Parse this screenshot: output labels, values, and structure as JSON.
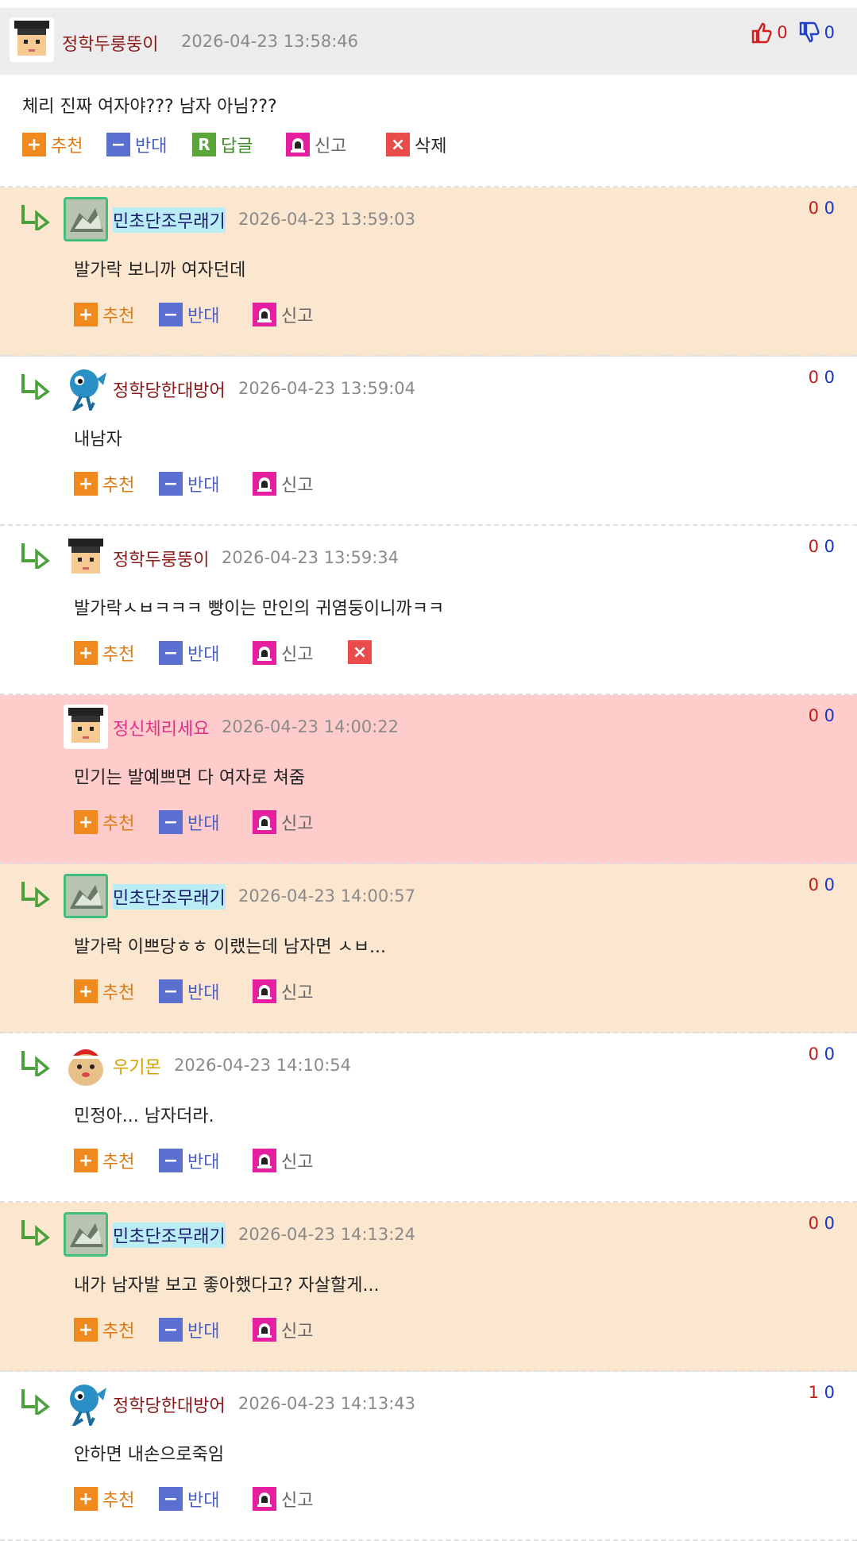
{
  "main": {
    "nick": "정학두룽뚱이",
    "date": "2026-04-23 13:58:46",
    "up": "0",
    "down": "0",
    "text": "체리 진짜 여자야??? 남자 아님???",
    "actions": {
      "recommend": "추천",
      "oppose": "반대",
      "reply": "답글",
      "report": "신고",
      "delete": "삭제"
    },
    "icon_r": "R"
  },
  "replies": [
    {
      "nick": "민초단조무래기",
      "date": "2026-04-23 13:59:03",
      "up": "0",
      "down": "0",
      "text": "발가락 보니까 여자던데",
      "bg": "#fbe6d0",
      "nickColor": "#1a1a6e",
      "avatar": "statue-icon"
    },
    {
      "nick": "정학당한대방어",
      "date": "2026-04-23 13:59:04",
      "up": "0",
      "down": "0",
      "text": "내남자",
      "bg": "#ffffff",
      "nickColor": "#8b1a1a",
      "avatar": "blue-fish-icon"
    },
    {
      "nick": "정학두룽뚱이",
      "date": "2026-04-23 13:59:34",
      "up": "0",
      "down": "0",
      "text": "발가락ㅅㅂㅋㅋㅋ 빵이는 만인의 귀염둥이니까ㅋㅋ",
      "bg": "#ffffff",
      "nickColor": "#8b1a1a",
      "avatar": "graduate-icon"
    },
    {
      "nick": "정신체리세요",
      "date": "2026-04-23 14:00:22",
      "up": "0",
      "down": "0",
      "text": "민기는 발예쁘면 다 여자로 쳐줌",
      "bg": "#ffcccc",
      "nickColor": "#e0308a",
      "avatar": "graduate-icon"
    },
    {
      "nick": "민초단조무래기",
      "date": "2026-04-23 14:00:57",
      "up": "0",
      "down": "0",
      "text": "발가락 이쁘당ㅎㅎ 이랬는데 남자면 ㅅㅂ...",
      "bg": "#fbe6d0",
      "nickColor": "#1a1a6e",
      "avatar": "statue-icon"
    },
    {
      "nick": "우기몬",
      "date": "2026-04-23 14:10:54",
      "up": "0",
      "down": "0",
      "text": "민정아... 남자더라.",
      "bg": "#ffffff",
      "nickColor": "#d4a000",
      "avatar": "pomeranian-icon"
    },
    {
      "nick": "민초단조무래기",
      "date": "2026-04-23 14:13:24",
      "up": "0",
      "down": "0",
      "text": "내가 남자발 보고 좋아했다고? 자살할게...",
      "bg": "#fbe6d0",
      "nickColor": "#1a1a6e",
      "avatar": "statue-icon"
    },
    {
      "nick": "정학당한대방어",
      "date": "2026-04-23 14:13:43",
      "up": "1",
      "down": "0",
      "text": "안하면 내손으로죽임",
      "bg": "#ffffff",
      "nickColor": "#8b1a1a",
      "avatar": "blue-fish-icon"
    }
  ],
  "reply_actions": {
    "recommend": "추천",
    "oppose": "반대",
    "report": "신고"
  },
  "colors": {
    "up": "#c41a1a",
    "down": "#1a36c4",
    "peach": "#fbe6d0",
    "pink": "#ffcccc"
  }
}
